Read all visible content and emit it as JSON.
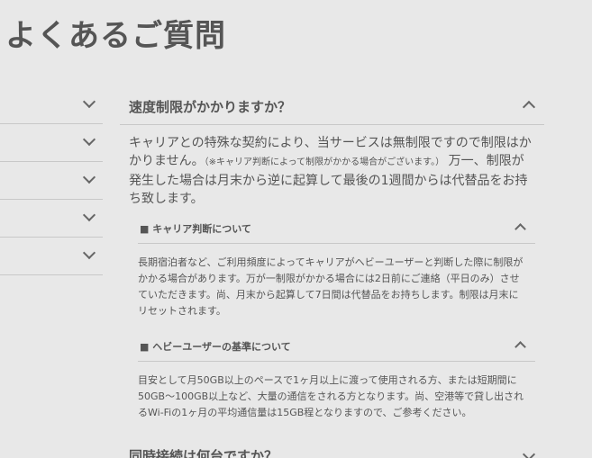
{
  "page": {
    "title": "よくあるご質問"
  },
  "left_list": {
    "count": 5
  },
  "main_question": {
    "title": "速度制限がかかりますか？",
    "answer_part1": "キャリアとの特殊な契約により、当サービスは無制限ですので制限はかかりません。",
    "answer_note": "（※キャリア判断によって制限がかかる場合がございます。）",
    "answer_part2": "万一、制限が発生した場合は月末から逆に起算して最後の1週間からは代替品をお持ち致します。"
  },
  "sub1": {
    "title": "■ キャリア判断について",
    "body": "長期宿泊者など、ご利用頻度によってキャリアがヘビーユーザーと判断した際に制限がかかる場合があります。万が一制限がかかる場合には2日前にご連絡（平日のみ）させていただきます。尚、月末から起算して7日間は代替品をお持ちします。制限は月末にリセットされます。"
  },
  "sub2": {
    "title": "■ ヘビーユーザーの基準について",
    "body": "目安として月50GB以上のペースで1ヶ月以上に渡って使用される方、または短期間に50GB～100GB以上など、大量の通信をされる方となります。尚、空港等で貸し出されるWi-Fiの1ヶ月の平均通信量は15GB程となりますので、ご参考ください。"
  },
  "next_question": {
    "title": "同時接続は何台ですか？"
  }
}
